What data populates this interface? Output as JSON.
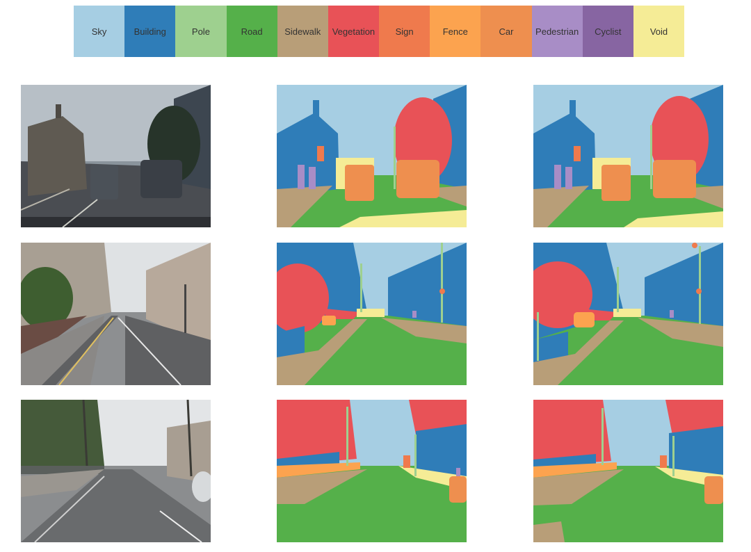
{
  "legend": [
    {
      "label": "Sky",
      "color": "#a6cee3"
    },
    {
      "label": "Building",
      "color": "#2f7db8"
    },
    {
      "label": "Pole",
      "color": "#9ed08f"
    },
    {
      "label": "Road",
      "color": "#55b04a"
    },
    {
      "label": "Sidewalk",
      "color": "#b89e78"
    },
    {
      "label": "Vegetation",
      "color": "#e85257"
    },
    {
      "label": "Sign",
      "color": "#ef7a4d"
    },
    {
      "label": "Fence",
      "color": "#fca34f"
    },
    {
      "label": "Car",
      "color": "#ee8f4f"
    },
    {
      "label": "Pedestrian",
      "color": "#a88dc6"
    },
    {
      "label": "Cyclist",
      "color": "#8765a2"
    },
    {
      "label": "Void",
      "color": "#f5ec96"
    }
  ],
  "columns": [
    "input-photo",
    "segmentation-result-a",
    "segmentation-result-b"
  ],
  "rows": [
    "street-scene-1",
    "street-scene-2",
    "street-scene-3"
  ]
}
